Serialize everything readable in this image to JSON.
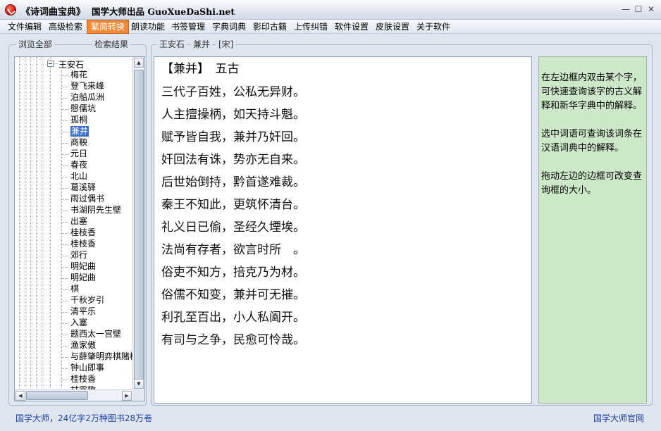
{
  "window": {
    "title": "《诗词曲宝典》",
    "subtitle": "国学大师出品 GuoXueDaShi.net",
    "min_glyph": "—",
    "max_glyph": "☐",
    "close_glyph": "✕"
  },
  "menu": [
    {
      "label": "文件编辑",
      "active": false
    },
    {
      "label": "高级检索",
      "active": false
    },
    {
      "label": "繁简转换",
      "active": true
    },
    {
      "label": "朗读功能",
      "active": false
    },
    {
      "label": "书签管理",
      "active": false
    },
    {
      "label": "字典词典",
      "active": false
    },
    {
      "label": "影印古籍",
      "active": false
    },
    {
      "label": "上传纠错",
      "active": false
    },
    {
      "label": "软件设置",
      "active": false
    },
    {
      "label": "皮肤设置",
      "active": false
    },
    {
      "label": "关于软件",
      "active": false
    }
  ],
  "left_panel": {
    "browse_label": "浏览全部",
    "search_label": "检索结果",
    "root": "王安石",
    "items": [
      "梅花",
      "登飞来峰",
      "泊船瓜洲",
      "慇儒坑",
      "孤桐",
      "兼并",
      "商鞅",
      "元日",
      "春夜",
      "北山",
      "葛溪驿",
      "雨过偶书",
      "书湖阴先生壁",
      "出塞",
      "桂枝香",
      "桂枝香",
      "郊行",
      "明妃曲",
      "明妃曲",
      "棋",
      "千秋岁引",
      "清平乐",
      "入塞",
      "题西太一宫壁",
      "渔家傲",
      "与薛肇明弈棋赌梅",
      "钟山即事",
      "桂枝香",
      "甘露歌"
    ],
    "selected_index": 5
  },
  "main": {
    "header": {
      "author": "王安石",
      "title": "兼并",
      "dynasty": "[宋]"
    },
    "poem_head": "【兼并】　五古",
    "lines": [
      "三代子百姓，公私无异财。",
      "人主擅操柄，如天持斗魁。",
      "赋予皆自我，兼并乃奸回。",
      "奸回法有诛，势亦无自来。",
      "后世始倒持，黔首遂难裁。",
      "秦王不知此，更筑怀清台。",
      "礼义日已偷，圣经久堙埃。",
      "法尚有存者，欲言时所　。",
      "俗吏不知方，掊克乃为材。",
      "俗儒不知变，兼并可无摧。",
      "利孔至百出，小人私阖开。",
      "有司与之争，民愈可怜哉。"
    ]
  },
  "help": [
    "在左边框内双击某个字，可快速查询该字的古义解释和新华字典中的解释。",
    "选中词语可查询该词条在汉语词典中的解释。",
    "拖动左边的边框可改变查询框的大小。"
  ],
  "status": {
    "left": "国学大师，24亿字2万种图书28万卷",
    "right": "国学大师官网"
  }
}
